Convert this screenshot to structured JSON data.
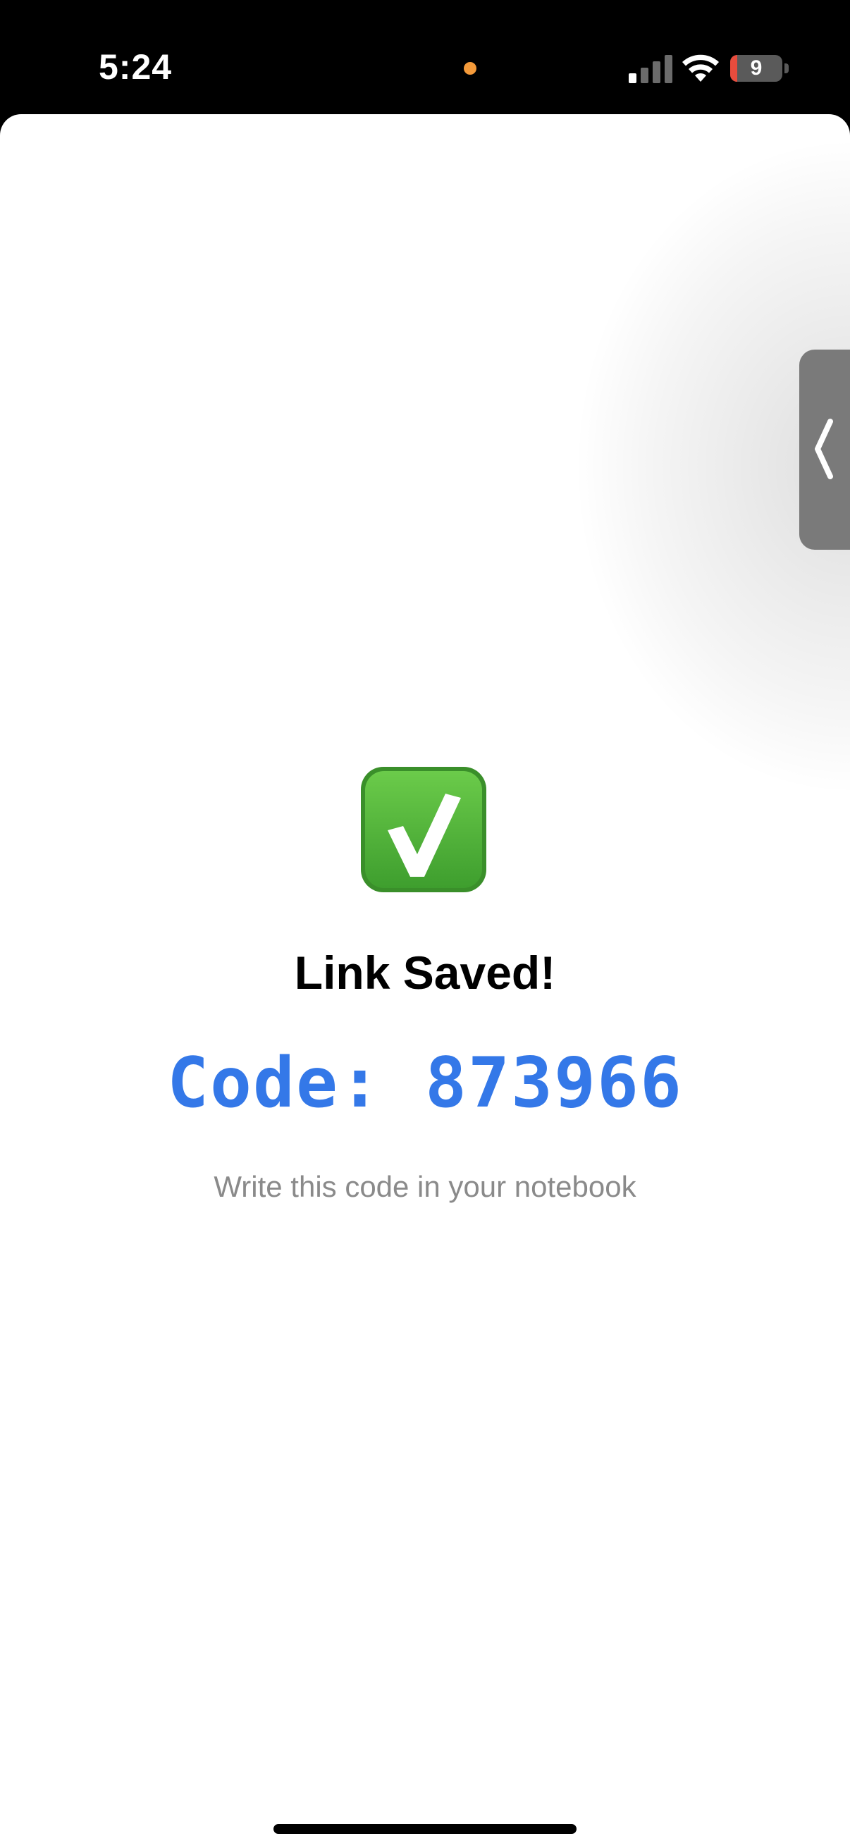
{
  "status_bar": {
    "time": "5:24",
    "battery_level": "9",
    "battery_fraction": 0.09,
    "privacy_dot_color": "#F49A3A",
    "signal_icon": "cellular-signal-icon",
    "wifi_icon": "wifi-icon",
    "battery_icon": "battery-icon"
  },
  "sheet": {
    "side_handle_icon": "chevron-left-icon"
  },
  "confirmation": {
    "icon": "check-mark-button-icon",
    "title": "Link Saved!",
    "code_text": "Code:  873966",
    "hint": "Write this code in your notebook"
  },
  "colors": {
    "accent": "#3478E8",
    "success_green": "#4CAF3A",
    "hint_gray": "#8a8a8a"
  }
}
